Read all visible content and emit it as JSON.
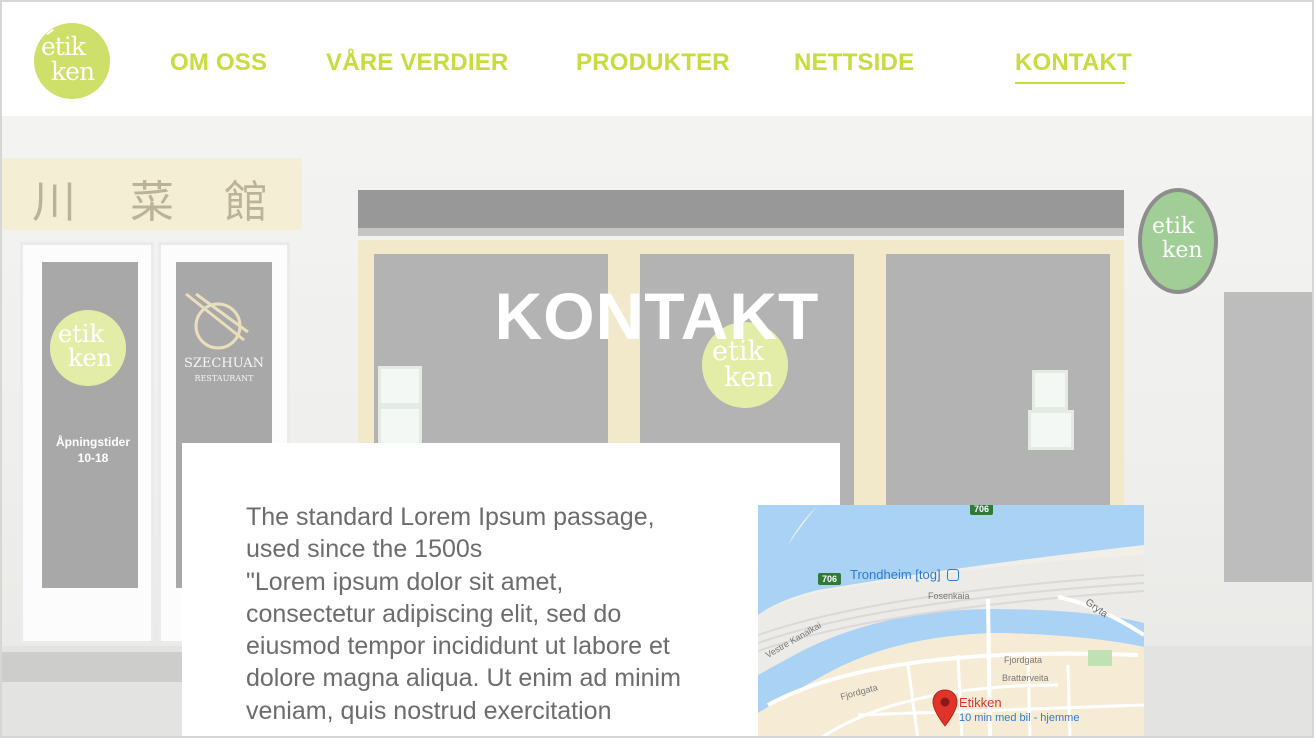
{
  "brand": {
    "logo_line1": "etik",
    "logo_line2": "ken",
    "colors": {
      "accent": "#c6dc3f",
      "logo_bg": "#cfe06a",
      "text": "#6c6c6c"
    }
  },
  "nav": {
    "items": [
      {
        "label": "OM OSS"
      },
      {
        "label": "VÅRE VERDIER"
      },
      {
        "label": "PRODUKTER"
      },
      {
        "label": "NETTSIDE"
      },
      {
        "label": "KONTAKT",
        "active": true
      }
    ]
  },
  "hero": {
    "title": "KONTAKT",
    "photo": {
      "sign_chars": [
        "川",
        "菜",
        "館"
      ],
      "door_logo_line1": "etik",
      "door_logo_line2": "ken",
      "restaurant_name": "SZECHUAN",
      "restaurant_sub": "RESTAURANT",
      "hours_label": "Åpningstider",
      "hours_value": "10-18",
      "window_logo_line1": "etik",
      "window_logo_line2": "ken",
      "hang_sign_line1": "etik",
      "hang_sign_line2": "ken"
    }
  },
  "content": {
    "paragraph_lines": [
      "The standard Lorem Ipsum passage,",
      "used since the 1500s",
      "\"Lorem ipsum dolor sit amet,",
      "consectetur adipiscing elit, sed do",
      "eiusmod tempor incididunt ut labore et",
      "dolore magna aliqua. Ut enim ad minim",
      "veniam, quis nostrud exercitation"
    ]
  },
  "map": {
    "station_label": "Trondheim [tog]",
    "road_badge_top": "706",
    "road_badge_left": "706",
    "street_fosenkaia": "Fosenkaia",
    "street_gryta": "Gryta",
    "street_vestre_kanalkai": "Vestre Kanalkai",
    "street_fjordgata_right": "Fjordgata",
    "street_brattorveita": "Brattørveita",
    "street_fjordgata_left": "Fjordgata",
    "pin_label": "Etikken",
    "pin_sublabel": "10 min med bil - hjemme",
    "colors": {
      "water": "#a9d2f5",
      "land": "#f2efe9",
      "pin": "#e0342a",
      "link": "#2a7ad6"
    }
  }
}
